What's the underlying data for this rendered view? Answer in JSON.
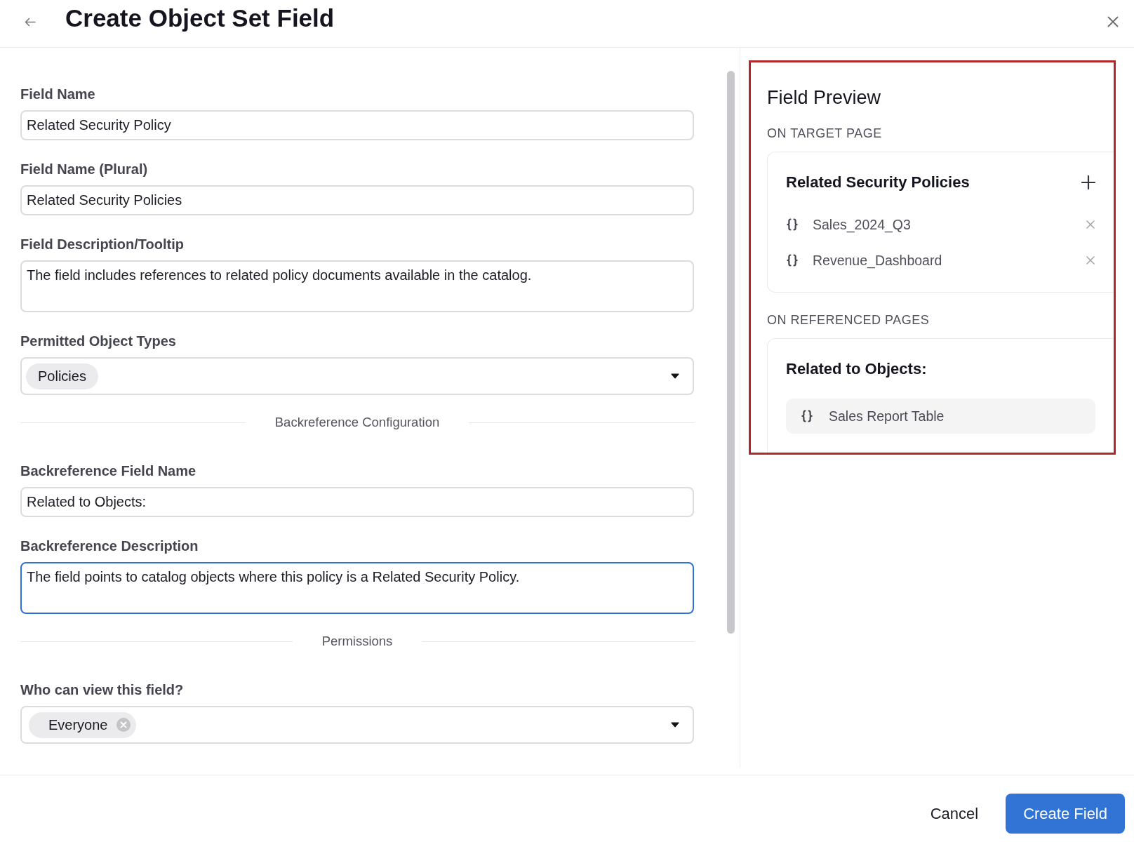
{
  "header": {
    "title": "Create Object Set Field"
  },
  "form": {
    "fields": [
      {
        "kind": "input",
        "label": "Field Name",
        "value": "Related Security Policy",
        "focused": false
      },
      {
        "kind": "input",
        "label": "Field Name (Plural)",
        "value": "Related Security Policies",
        "focused": false
      },
      {
        "kind": "textarea",
        "label": "Field Description/Tooltip",
        "value": "The field includes references to related policy documents available in the catalog.",
        "focused": false
      },
      {
        "kind": "select",
        "label": "Permitted Object Types",
        "focused": false,
        "chips": [
          {
            "label": "Policies",
            "removable": false
          }
        ]
      },
      {
        "kind": "divider",
        "label": "Backreference Configuration"
      },
      {
        "kind": "input",
        "label": "Backreference Field Name",
        "value": "Related to Objects:",
        "focused": false
      },
      {
        "kind": "textarea",
        "label": "Backreference Description",
        "value": "The field points to catalog objects where this policy is a Related Security Policy.",
        "focused": true
      },
      {
        "kind": "divider",
        "label": "Permissions"
      },
      {
        "kind": "select",
        "label": "Who can view this field?",
        "focused": false,
        "chips": [
          {
            "label": "Everyone",
            "removable": true
          }
        ]
      }
    ]
  },
  "preview": {
    "title": "Field Preview",
    "sections": [
      {
        "kind": "list",
        "heading": "ON TARGET PAGE",
        "card_title": "Related Security Policies",
        "items": [
          "Sales_2024_Q3",
          "Revenue_Dashboard"
        ]
      },
      {
        "kind": "reference",
        "heading": "ON REFERENCED PAGES",
        "card_title": "Related to Objects:",
        "items": [
          "Sales Report Table"
        ]
      }
    ]
  },
  "footer": {
    "buttons": [
      {
        "kind": "secondary",
        "label": "Cancel"
      },
      {
        "kind": "primary",
        "label": "Create Field"
      }
    ]
  }
}
